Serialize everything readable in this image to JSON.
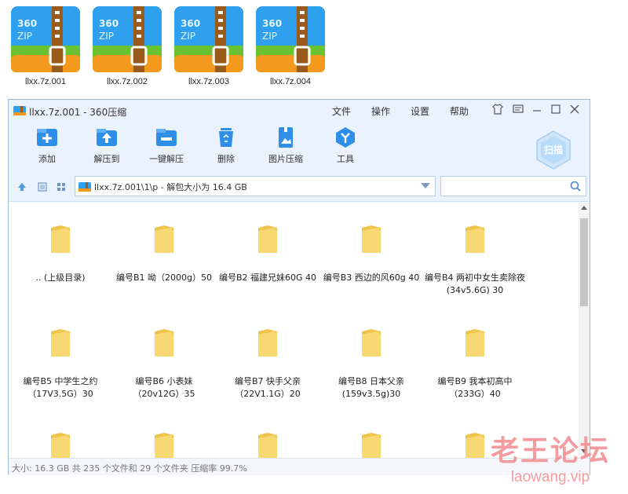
{
  "desktop": {
    "files": [
      {
        "name": "llxx.7z.001",
        "badge": "360",
        "type": "ZIP"
      },
      {
        "name": "llxx.7z.002",
        "badge": "360",
        "type": "ZIP"
      },
      {
        "name": "llxx.7z.003",
        "badge": "360",
        "type": "ZIP"
      },
      {
        "name": "llxx.7z.004",
        "badge": "360",
        "type": "ZIP"
      }
    ]
  },
  "window": {
    "title": "llxx.7z.001 - 360压缩",
    "menu": [
      "文件",
      "操作",
      "设置",
      "帮助"
    ],
    "toolbar": [
      "添加",
      "解压到",
      "一键解压",
      "删除",
      "图片压缩",
      "工具"
    ],
    "scan_label": "扫描",
    "address": "llxx.7z.001\\1\\p - 解包大小为 16.4 GB",
    "search_placeholder": ""
  },
  "files": [
    ".. (上级目录)",
    "编号B1  呦（2000g）50",
    "编号B2 福建兄妹60G 40",
    "编号B3   西边的风60g 40",
    "编号B4 两初中女生卖除夜(34v5.6G) 30",
    "编号B5 中学生之约（17V3.5G）30",
    "编号B6 小表妹（20v12G）35",
    "编号B7 快手父亲（22V1.1G）20",
    "编号B8 日本父亲(159v3.5g)30",
    "编号B9 我本初高中（233G）40"
  ],
  "status": "大小: 16.3 GB 共 235 个文件和 29 个文件夹 压缩率 99.7%",
  "watermark": {
    "text": "老王论坛",
    "url": "laowang.vip"
  },
  "colors": {
    "accent": "#2f8fe8",
    "folder": "#f5cc5b",
    "watermark": "#f28a8f"
  }
}
